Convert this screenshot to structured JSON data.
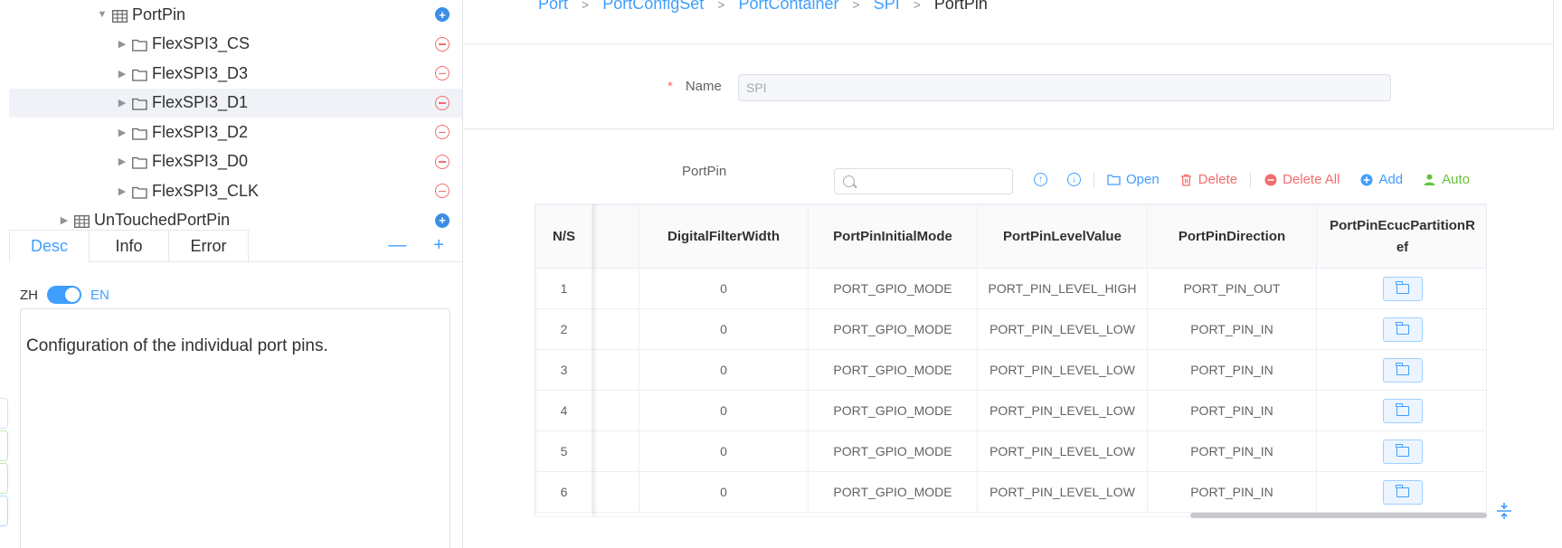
{
  "tree": {
    "items": [
      {
        "label": "PortPin",
        "indent": 2,
        "icon": "table-icon",
        "expanded": true,
        "action": "add"
      },
      {
        "label": "FlexSPI3_CS",
        "indent": 3,
        "icon": "folder-icon",
        "action": "remove"
      },
      {
        "label": "FlexSPI3_D3",
        "indent": 3,
        "icon": "folder-icon",
        "action": "remove"
      },
      {
        "label": "FlexSPI3_D1",
        "indent": 3,
        "icon": "folder-icon",
        "action": "remove",
        "highlight": true
      },
      {
        "label": "FlexSPI3_D2",
        "indent": 3,
        "icon": "folder-icon",
        "action": "remove"
      },
      {
        "label": "FlexSPI3_D0",
        "indent": 3,
        "icon": "folder-icon",
        "action": "remove"
      },
      {
        "label": "FlexSPI3_CLK",
        "indent": 3,
        "icon": "folder-icon",
        "action": "remove"
      },
      {
        "label": "UnTouchedPortPin",
        "indent": 1,
        "icon": "table-icon",
        "action": "add"
      }
    ]
  },
  "tabs": {
    "desc": "Desc",
    "info": "Info",
    "error": "Error",
    "minus": "—",
    "plus": "+"
  },
  "lang": {
    "zh": "ZH",
    "en": "EN"
  },
  "description": "Configuration of the individual port pins.",
  "breadcrumb": [
    "Port",
    "PortConfigSet",
    "PortContainer",
    "SPI",
    "PortPin"
  ],
  "form": {
    "name_label": "Name",
    "required_mark": "*",
    "name_value": "SPI"
  },
  "portpin": {
    "label": "PortPin",
    "toolbar": {
      "open": "Open",
      "delete": "Delete",
      "delete_all": "Delete All",
      "add": "Add",
      "auto": "Auto"
    }
  },
  "table": {
    "headers": [
      "N/S",
      "",
      "DigitalFilterWidth",
      "PortPinInitialMode",
      "PortPinLevelValue",
      "PortPinDirection",
      "PortPinEcucPartitionRef"
    ],
    "rows": [
      [
        "1",
        "",
        "0",
        "PORT_GPIO_MODE",
        "PORT_PIN_LEVEL_HIGH",
        "PORT_PIN_OUT"
      ],
      [
        "2",
        "",
        "0",
        "PORT_GPIO_MODE",
        "PORT_PIN_LEVEL_LOW",
        "PORT_PIN_IN"
      ],
      [
        "3",
        "",
        "0",
        "PORT_GPIO_MODE",
        "PORT_PIN_LEVEL_LOW",
        "PORT_PIN_IN"
      ],
      [
        "4",
        "",
        "0",
        "PORT_GPIO_MODE",
        "PORT_PIN_LEVEL_LOW",
        "PORT_PIN_IN"
      ],
      [
        "5",
        "",
        "0",
        "PORT_GPIO_MODE",
        "PORT_PIN_LEVEL_LOW",
        "PORT_PIN_IN"
      ],
      [
        "6",
        "",
        "0",
        "PORT_GPIO_MODE",
        "PORT_PIN_LEVEL_LOW",
        "PORT_PIN_IN"
      ]
    ]
  },
  "colors": {
    "accent": "#409eff",
    "danger": "#f56c6c",
    "success": "#67c23a",
    "tree_highlight": "#f0f2f8"
  }
}
